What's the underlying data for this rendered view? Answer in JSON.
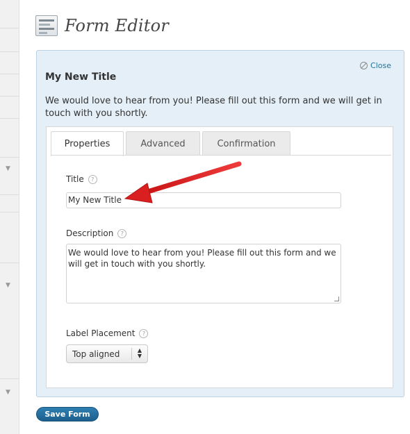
{
  "header": {
    "title": "Form Editor",
    "icon": "form-icon"
  },
  "editor": {
    "close_label": "Close",
    "form_title": "My New Title",
    "form_description": "We would love to hear from you! Please fill out this form and we will get in touch with you shortly.",
    "tabs": [
      {
        "label": "Properties",
        "active": true
      },
      {
        "label": "Advanced",
        "active": false
      },
      {
        "label": "Confirmation",
        "active": false
      }
    ],
    "fields": {
      "title_label": "Title",
      "title_value": "My New Title",
      "description_label": "Description",
      "description_value": "We would love to hear from you! Please fill out this form and we will get in touch with you shortly.",
      "label_placement_label": "Label Placement",
      "label_placement_value": "Top aligned",
      "help_glyph": "?"
    }
  },
  "footer": {
    "save_label": "Save Form"
  },
  "colors": {
    "accent": "#21759b",
    "panel_bg": "#e4eff8",
    "save_button": "#2376a7",
    "annotation_arrow": "#e42727"
  }
}
